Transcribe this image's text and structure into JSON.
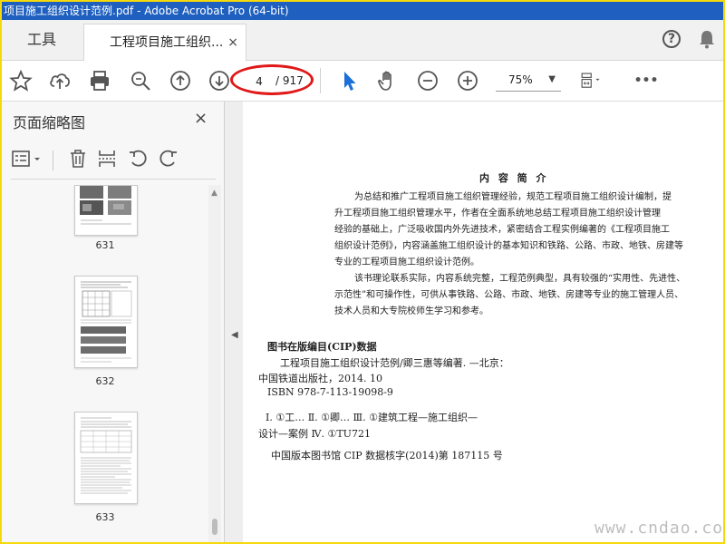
{
  "window": {
    "title": "项目施工组织设计范例.pdf - Adobe Acrobat Pro (64-bit)"
  },
  "tabs": {
    "tools_label": "工具",
    "document_label": "工程项目施工组织...",
    "close_symbol": "×"
  },
  "toolbar": {
    "current_page": "4",
    "total_pages": "/ 917",
    "zoom": "75%",
    "more_symbol": "•••"
  },
  "thumbnail_panel": {
    "title": "页面缩略图",
    "close_symbol": "×",
    "pages": [
      {
        "label": "631"
      },
      {
        "label": "632"
      },
      {
        "label": "633"
      }
    ]
  },
  "document": {
    "intro_title": "内 容 简 介",
    "intro_lines": [
      "为总结和推广工程项目施工组织管理经验，规范工程项目施工组织设计编制，提",
      "升工程项目施工组织管理水平，作者在全面系统地总结工程项目施工组织设计管理",
      "经验的基础上，广泛吸收国内外先进技术，紧密结合工程实例编著的《工程项目施工",
      "组织设计范例》，内容涵盖施工组织设计的基本知识和铁路、公路、市政、地铁、房建等",
      "专业的工程项目施工组织设计范例。",
      "该书理论联系实际，内容系统完整，工程范例典型，具有较强的“实用性、先进性、",
      "示范性”和可操作性，可供从事铁路、公路、市政、地铁、房建等专业的施工管理人员、",
      "技术人员和大专院校师生学习和参考。"
    ],
    "cip_heading": "图书在版编目(CIP)数据",
    "cip_lines": [
      "工程项目施工组织设计范例/卿三惠等编著. —北京：",
      "中国铁道出版社，2014. 10",
      "ISBN 978-7-113-19098-9",
      "Ⅰ. ①工… Ⅱ. ①卿… Ⅲ. ①建筑工程—施工组织—",
      "设计—案例 Ⅳ. ①TU721",
      "中国版本图书馆 CIP 数据核字(2014)第 187115 号"
    ],
    "site_mark": "www.cndao.com"
  },
  "colors": {
    "titlebar": "#1e5fbf",
    "frame": "#f5d90a",
    "annotation": "#e01818",
    "cursor_icon": "#1a6fd8"
  }
}
